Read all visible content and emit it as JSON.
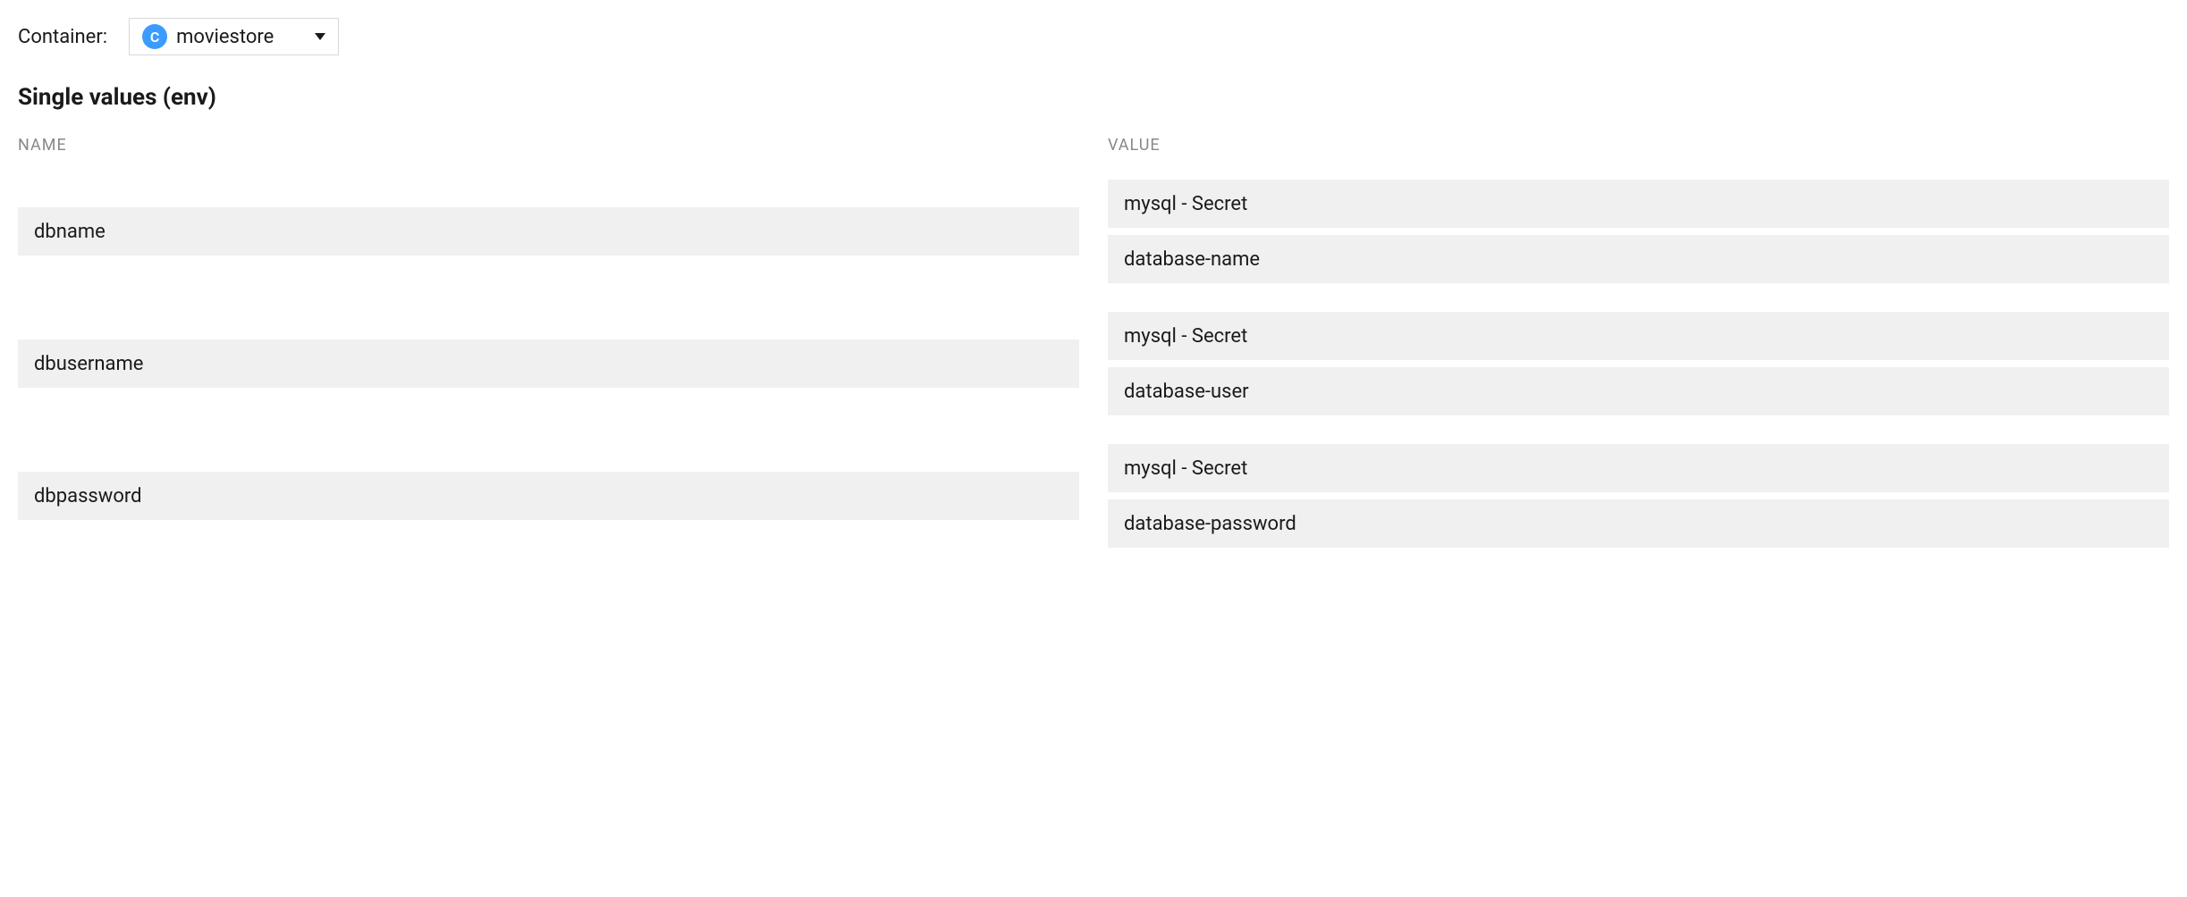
{
  "container": {
    "label": "Container:",
    "badge_letter": "C",
    "selected": "moviestore"
  },
  "section_title": "Single values (env)",
  "table": {
    "headers": {
      "name": "NAME",
      "value": "VALUE"
    },
    "rows": [
      {
        "name": "dbname",
        "value_source": "mysql - Secret",
        "value_key": "database-name"
      },
      {
        "name": "dbusername",
        "value_source": "mysql - Secret",
        "value_key": "database-user"
      },
      {
        "name": "dbpassword",
        "value_source": "mysql - Secret",
        "value_key": "database-password"
      }
    ]
  }
}
